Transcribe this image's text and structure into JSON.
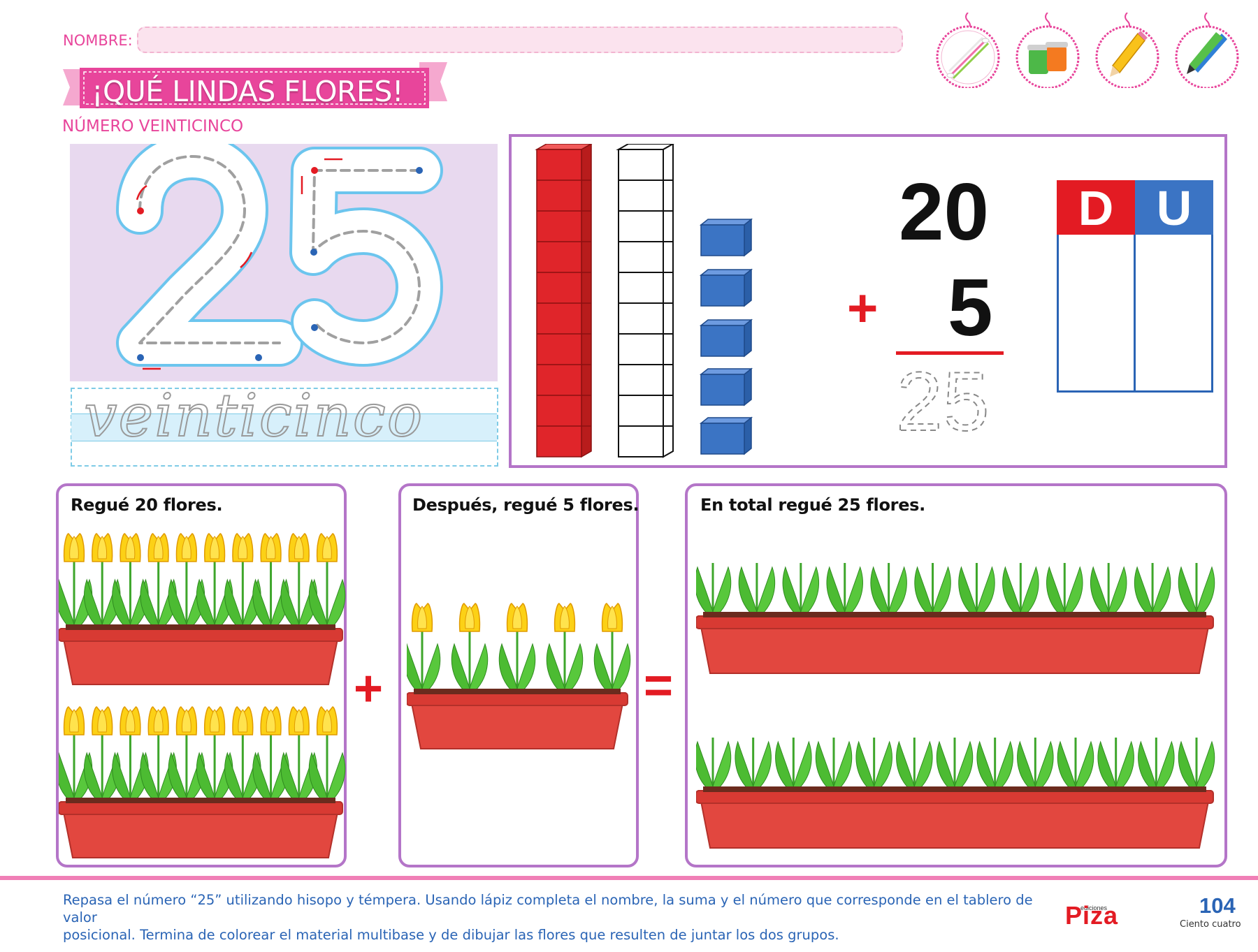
{
  "header": {
    "name_label": "NOMBRE:",
    "title": "¡QUÉ LINDAS FLORES!",
    "subtitle": "NÚMERO VEINTICINCO"
  },
  "tools": [
    {
      "icon": "cotton-swab-icon"
    },
    {
      "icon": "paint-jars-icon"
    },
    {
      "icon": "pencil-icon"
    },
    {
      "icon": "markers-icon"
    }
  ],
  "tracing": {
    "number": "25",
    "word": "veinticinco"
  },
  "addition": {
    "top": "20",
    "bottom": "5",
    "operator": "+",
    "result": "25"
  },
  "place_value": {
    "tens_header": "D",
    "units_header": "U"
  },
  "base_ten": {
    "rods": 2,
    "units": 5
  },
  "panels": {
    "first": {
      "text": "Regué 20 flores.",
      "pots": 2,
      "flowers_per_pot": 10
    },
    "second": {
      "text": "Después, regué 5 flores.",
      "pots": 1,
      "flowers_per_pot": 5
    },
    "third": {
      "text": "En total regué 25 flores.",
      "pots": 2
    },
    "plus_sign": "+",
    "equals_sign": "="
  },
  "footer": {
    "instructions_line1": "Repasa el número “25” utilizando hisopo y témpera. Usando lápiz completa el nombre, la suma y el número que corresponde en el tablero de valor",
    "instructions_line2": "posicional. Termina de colorear el material multibase y de dibujar las flores que resulten de juntar los dos grupos.",
    "logo_small": "ediciones",
    "logo": "Piza",
    "page_number": "104",
    "page_words": "Ciento cuatro"
  },
  "colors": {
    "pink": "#e8459b",
    "purple_border": "#b475c8",
    "red": "#e31b23",
    "blue": "#2a64b5",
    "rod_red": "#e0252a",
    "cube_blue": "#3b74c4"
  }
}
